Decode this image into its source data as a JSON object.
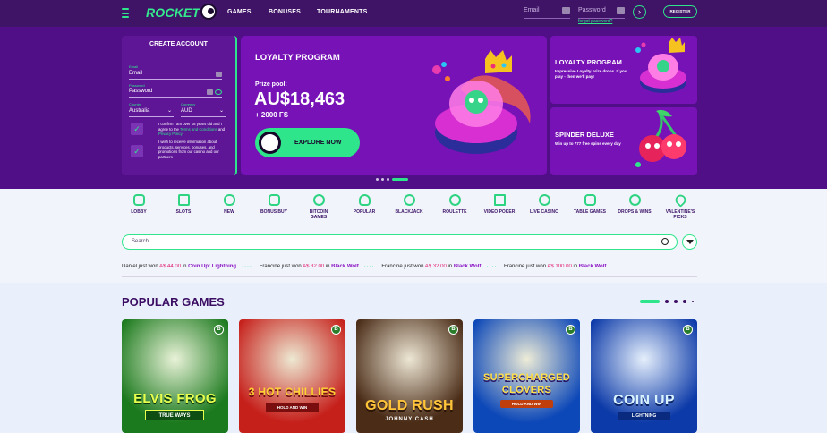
{
  "header": {
    "logo": "ROCKET",
    "nav": [
      "GAMES",
      "BONUSES",
      "TOURNAMENTS"
    ],
    "email_placeholder": "Email",
    "password_placeholder": "Password",
    "forgot": "forgot password?",
    "arrow": "›",
    "register": "REGISTER"
  },
  "create": {
    "title": "CREATE ACCOUNT",
    "email_label": "Email",
    "email_value": "Email",
    "password_label": "Password",
    "password_value": "Password",
    "country_label": "Country",
    "country_value": "Australia",
    "currency_label": "Currency",
    "currency_value": "AUD",
    "confirm_text_1": "I confirm I am over 18 years old and I agree to the ",
    "confirm_link_1": "Terms and Conditions",
    "confirm_text_2": " and ",
    "confirm_link_2": "Privacy Policy",
    "promo_text": "I wish to receive information about products, services, bonuses, and promotions from our casino and our partners"
  },
  "promo": {
    "title": "LOYALTY PROGRAM",
    "prize_label": "Prize pool:",
    "amount": "AU$18,463",
    "fs": "+ 2000 FS",
    "cta": "EXPLORE NOW"
  },
  "side": [
    {
      "title": "LOYALTY PROGRAM",
      "desc": "Impressive Loyalty prize drops. If you play - then we'll pay!"
    },
    {
      "title": "SPINDER DELUXE",
      "desc": "Win up to 777 free spins every day"
    }
  ],
  "categories": [
    "LOBBY",
    "SLOTS",
    "NEW",
    "BONUS BUY",
    "BITCOIN GAMES",
    "POPULAR",
    "BLACKJACK",
    "ROULETTE",
    "VIDEO POKER",
    "LIVE CASINO",
    "TABLE GAMES",
    "DROPS & WINS",
    "VALENTINE'S PICKS"
  ],
  "search": {
    "placeholder": "Search"
  },
  "ticker": [
    {
      "who": "Daniel just won",
      "amount": "A$ 44.00",
      "mid": "in",
      "game": "Coin Up: Lightning"
    },
    {
      "who": "Francine just won",
      "amount": "A$ 32.00",
      "mid": "in",
      "game": "Black Wolf"
    },
    {
      "who": "Francine just won",
      "amount": "A$ 32.00",
      "mid": "in",
      "game": "Black Wolf"
    },
    {
      "who": "Francine just won",
      "amount": "A$ 100.00",
      "mid": "in",
      "game": "Black Wolf"
    }
  ],
  "popular": {
    "title": "POPULAR GAMES",
    "games": [
      {
        "title": "ELVIS FROG",
        "sub": "TRUE WAYS",
        "bg": "#1c7a1e",
        "fg": "#e8ff4d"
      },
      {
        "title": "3 HOT CHILLIES",
        "sub": "HOLD AND WIN",
        "bg": "#c6201b",
        "fg": "#ffd233"
      },
      {
        "title": "GOLD RUSH",
        "sub": "JOHNNY CASH",
        "bg": "#4a2c17",
        "fg": "#ffc43a"
      },
      {
        "title": "SUPERCHARGED CLOVERS",
        "sub": "HOLD AND WIN",
        "bg": "#0d48b8",
        "fg": "#ffe047"
      },
      {
        "title": "COIN UP",
        "sub": "LIGHTNING",
        "bg": "#0c3aa8",
        "fg": "#d9f2ff"
      }
    ]
  }
}
